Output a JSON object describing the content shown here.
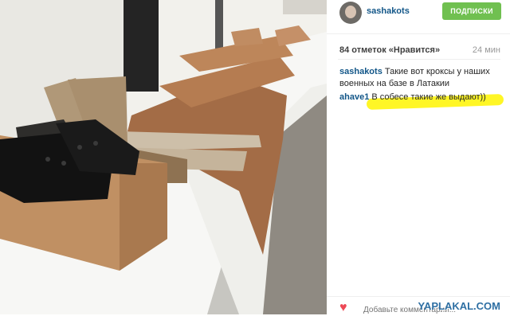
{
  "post": {
    "username": "sashakots",
    "follow_label": "ПОДПИСКИ",
    "likes": "84 отметок «Нравится»",
    "time": "24 мин",
    "comments": [
      {
        "user": "sashakots",
        "text": "Такие вот кроксы у наших военных на базе в Латакии"
      },
      {
        "user": "ahave1",
        "text": "В собесе такие же выдают))"
      }
    ],
    "add_comment_placeholder": "Добавьте комментарий..."
  },
  "watermark": "YAPLAKAL.COM",
  "colors": {
    "like": "#ed4956",
    "link": "#125688",
    "follow": "#70c050",
    "highlight": "#fff400"
  },
  "icons": [
    "avatar",
    "heart-icon"
  ]
}
